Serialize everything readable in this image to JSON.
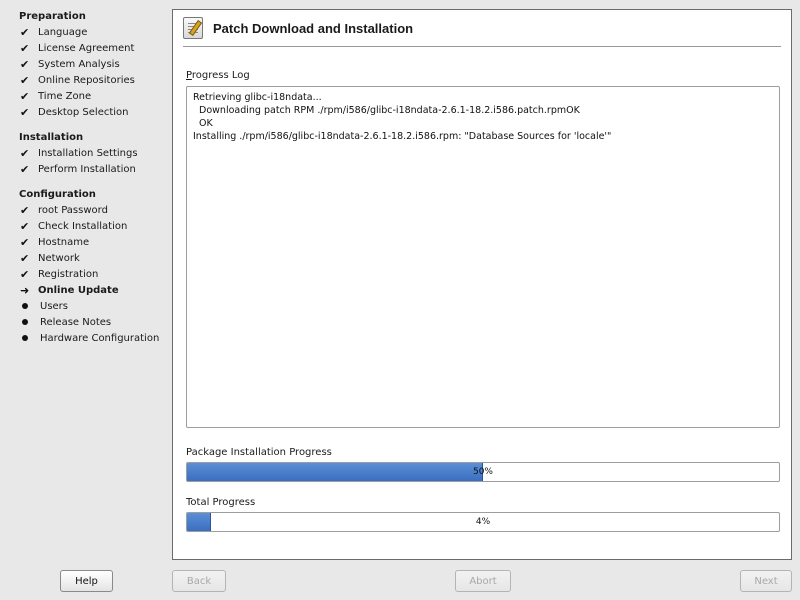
{
  "sidebar": {
    "sections": [
      {
        "title": "Preparation",
        "items": [
          {
            "label": "Language",
            "state": "done"
          },
          {
            "label": "License Agreement",
            "state": "done"
          },
          {
            "label": "System Analysis",
            "state": "done"
          },
          {
            "label": "Online Repositories",
            "state": "done"
          },
          {
            "label": "Time Zone",
            "state": "done"
          },
          {
            "label": "Desktop Selection",
            "state": "done"
          }
        ]
      },
      {
        "title": "Installation",
        "items": [
          {
            "label": "Installation Settings",
            "state": "done"
          },
          {
            "label": "Perform Installation",
            "state": "done"
          }
        ]
      },
      {
        "title": "Configuration",
        "items": [
          {
            "label": "root Password",
            "state": "done"
          },
          {
            "label": "Check Installation",
            "state": "done"
          },
          {
            "label": "Hostname",
            "state": "done"
          },
          {
            "label": "Network",
            "state": "done"
          },
          {
            "label": "Registration",
            "state": "done"
          },
          {
            "label": "Online Update",
            "state": "current"
          },
          {
            "label": "Users",
            "state": "pending"
          },
          {
            "label": "Release Notes",
            "state": "pending"
          },
          {
            "label": "Hardware Configuration",
            "state": "pending"
          }
        ]
      }
    ]
  },
  "main": {
    "title": "Patch Download and Installation",
    "header_icon": "edit-document-icon",
    "log": {
      "label_prefix": "P",
      "label_rest": "rogress Log",
      "lines": [
        "Retrieving glibc-i18ndata...",
        "  Downloading patch RPM ./rpm/i586/glibc-i18ndata-2.6.1-18.2.i586.patch.rpmOK",
        "  OK",
        "Installing ./rpm/i586/glibc-i18ndata-2.6.1-18.2.i586.rpm: \"Database Sources for 'locale'\""
      ]
    },
    "package_progress": {
      "label": "Package Installation Progress",
      "percent": 50,
      "text": "50%"
    },
    "total_progress": {
      "label": "Total Progress",
      "percent": 4,
      "text": "4%"
    }
  },
  "buttons": {
    "help": "Help",
    "back": "Back",
    "abort": "Abort",
    "next": "Next"
  },
  "colors": {
    "progress_fill": "#3a6fc0",
    "panel_bg": "#ffffff",
    "window_bg": "#e8e8e8"
  }
}
